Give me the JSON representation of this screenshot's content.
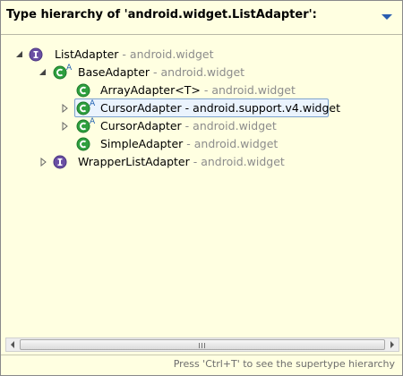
{
  "header": {
    "title": "Type hierarchy of 'android.widget.ListAdapter':"
  },
  "tree": {
    "rows": [
      {
        "name": "ListAdapter",
        "pkg": "android.widget",
        "sep": " - "
      },
      {
        "name": "BaseAdapter",
        "pkg": "android.widget",
        "sep": " - "
      },
      {
        "name": "ArrayAdapter<T>",
        "pkg": "android.widget",
        "sep": " - "
      },
      {
        "name": "CursorAdapter",
        "pkg": "android.support.v4.widget",
        "sep": " - "
      },
      {
        "name": "CursorAdapter",
        "pkg": "android.widget",
        "sep": " - "
      },
      {
        "name": "SimpleAdapter",
        "pkg": "android.widget",
        "sep": " - "
      },
      {
        "name": "WrapperListAdapter",
        "pkg": "android.widget",
        "sep": " - "
      }
    ],
    "abstract_mark": "A",
    "interface_mark": "I",
    "class_mark": "C"
  },
  "footer": {
    "hint": "Press 'Ctrl+T' to see the supertype hierarchy"
  },
  "colors": {
    "background": "#ffffe1",
    "class_icon": "#2e9f3e",
    "interface_icon": "#6a4fa3",
    "selection": "#7da2ce"
  }
}
